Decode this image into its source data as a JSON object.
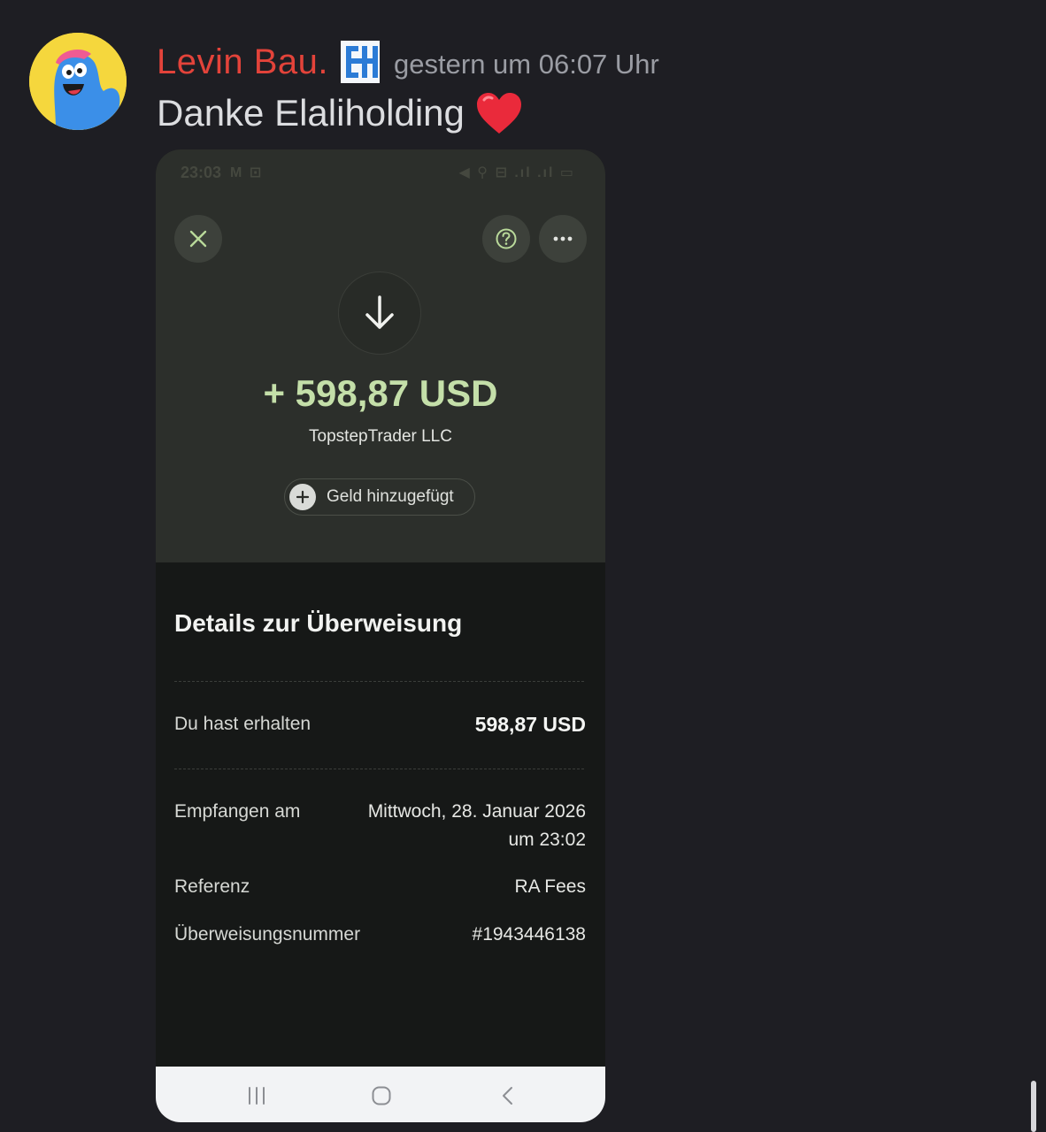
{
  "message": {
    "username": "Levin Bau.",
    "timestamp": "gestern um 06:07 Uhr",
    "text": "Danke Elaliholding",
    "emoji_icon": "red-heart-icon",
    "avatar_icon": "blue-monster-avatar-icon",
    "role_badge_icon": "eh-logo-badge-icon"
  },
  "screenshot": {
    "status_bar": {
      "time": "23:03",
      "left_icons": "M ⊡",
      "right_icons": "◀ ⚲ ⊟ .ıl .ıl ▭"
    },
    "top_bar": {
      "close_icon": "close-icon",
      "help_icon": "help-icon",
      "more_icon": "more-icon"
    },
    "transfer": {
      "amount": "+ 598,87 USD",
      "payer": "TopstepTrader LLC",
      "status_pill": "Geld hinzugefügt",
      "accent_color": "#c4dfa9"
    },
    "details": {
      "title": "Details zur Überweisung",
      "received_label": "Du hast erhalten",
      "received_value": "598,87 USD",
      "date_label": "Empfangen am",
      "date_value_line1": "Mittwoch, 28. Januar 2026",
      "date_value_line2": "um 23:02",
      "reference_label": "Referenz",
      "reference_value": "RA Fees",
      "transfer_no_label": "Überweisungsnummer",
      "transfer_no_value": "#1943446138"
    }
  }
}
